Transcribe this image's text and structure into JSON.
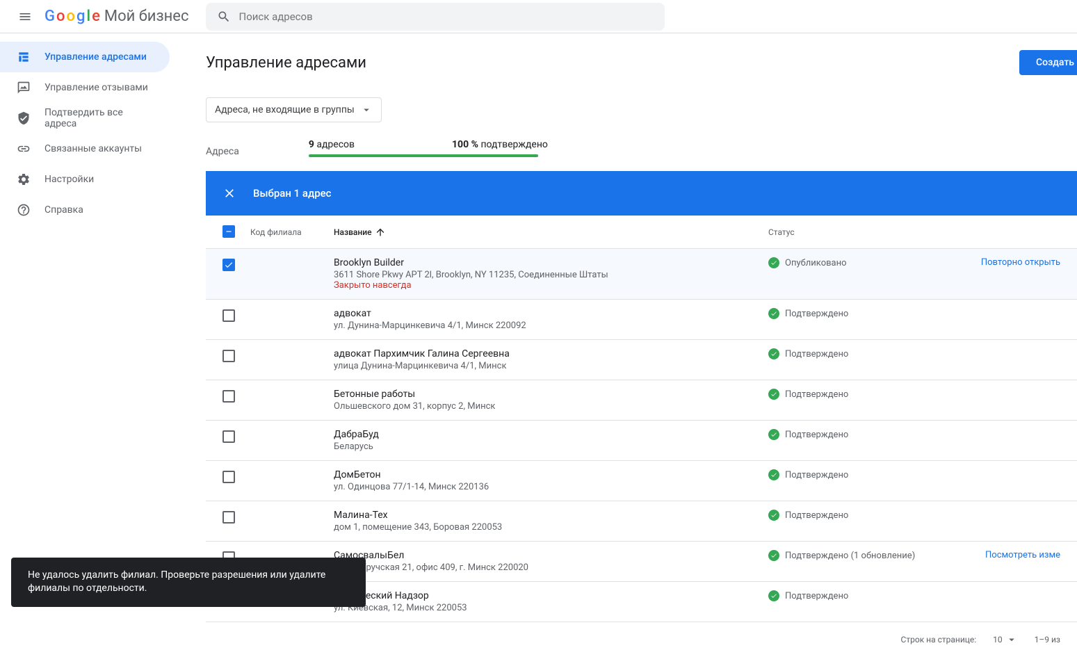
{
  "header": {
    "product_suffix": "Мой бизнес",
    "search_placeholder": "Поиск адресов"
  },
  "sidebar": {
    "items": [
      {
        "label": "Управление адресами"
      },
      {
        "label": "Управление отзывами"
      },
      {
        "label": "Подтвердить все адреса"
      },
      {
        "label": "Связанные аккаунты"
      },
      {
        "label": "Настройки"
      },
      {
        "label": "Справка"
      }
    ]
  },
  "main": {
    "title": "Управление адресами",
    "create_btn": "Создать",
    "filter_label": "Адреса, не входящие в группы",
    "stats_label": "Адреса",
    "addresses_count": "9",
    "addresses_word": "адресов",
    "confirmed_pct": "100 %",
    "confirmed_word": "подтверждено"
  },
  "selection": {
    "text": "Выбран 1 адрес"
  },
  "columns": {
    "code": "Код филиала",
    "name": "Название",
    "status": "Статус"
  },
  "rows": [
    {
      "checked": true,
      "name": "Brooklyn Builder",
      "addr": "3611 Shore Pkwy APT 2l, Brooklyn, NY 11235, Соединенные Штаты",
      "closed": "Закрыто навсегда",
      "status": "Опубликовано",
      "action": "Повторно открыть"
    },
    {
      "checked": false,
      "name": "адвокат",
      "addr": "ул. Дунина-Марцинкевича 4/1, Минск 220092",
      "status": "Подтверждено"
    },
    {
      "checked": false,
      "name": "адвокат Пархимчик Галина Сергеевна",
      "addr": "улица Дунина-Марцинкевича 4/1, Минск",
      "status": "Подтверждено"
    },
    {
      "checked": false,
      "name": "Бетонные работы",
      "addr": "Ольшевского дом 31, корпус 2, Минск",
      "status": "Подтверждено"
    },
    {
      "checked": false,
      "name": "ДабраБуд",
      "addr": "Беларусь",
      "status": "Подтверждено"
    },
    {
      "checked": false,
      "name": "ДомБетон",
      "addr": "ул. Одинцова 77/1-14, Минск 220136",
      "status": "Подтверждено"
    },
    {
      "checked": false,
      "name": "Малина-Тех",
      "addr": "дом 1, помещение 343, Боровая 220053",
      "status": "Подтверждено"
    },
    {
      "checked": false,
      "name": "СамосвалыБел",
      "addr": "улица Уручская 21, офис 409, г. Минск 220020",
      "status": "Подтверждено (1 обновление)",
      "action": "Посмотреть изме"
    },
    {
      "checked": false,
      "name": "Технический Надзор",
      "addr": "ул. Киевская, 12, Минск 220053",
      "status": "Подтверждено"
    }
  ],
  "pager": {
    "rows_label": "Строк на странице:",
    "per_page": "10",
    "range": "1–9 из"
  },
  "toast": "Не удалось удалить филиал. Проверьте разрешения или удалите филиалы по отдельности."
}
